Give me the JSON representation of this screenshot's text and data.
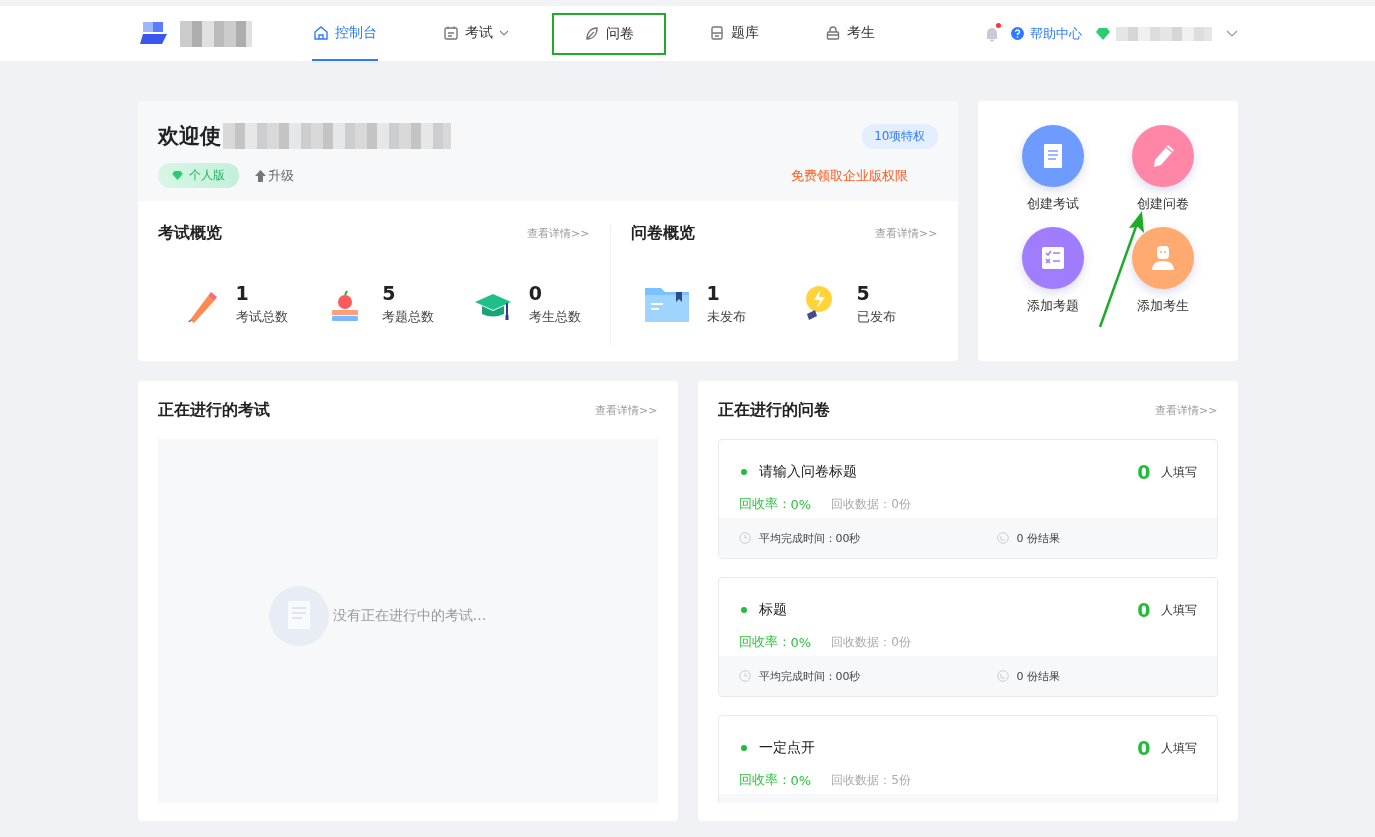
{
  "nav": {
    "items": [
      {
        "label": "控制台",
        "kind": "home",
        "selected": true,
        "dropdown": false,
        "highlighted": false
      },
      {
        "label": "考试",
        "kind": "calendar",
        "selected": false,
        "dropdown": true,
        "highlighted": false
      },
      {
        "label": "问卷",
        "kind": "leaf",
        "selected": false,
        "dropdown": false,
        "highlighted": true
      },
      {
        "label": "题库",
        "kind": "archive",
        "selected": false,
        "dropdown": false,
        "highlighted": false
      },
      {
        "label": "考生",
        "kind": "lock",
        "selected": false,
        "dropdown": false,
        "highlighted": false
      }
    ],
    "notification_dot": true,
    "help": "帮助中心"
  },
  "welcome": {
    "title": "欢迎使",
    "edition": "个人版",
    "upgrade": "升级",
    "badge": "10项特权",
    "promo": "免费领取企业版权限"
  },
  "exam_overview": {
    "title": "考试概览",
    "link": "查看详情>>",
    "stats": [
      {
        "kind": "pencil",
        "value": "1",
        "label": "考试总数"
      },
      {
        "kind": "books",
        "value": "5",
        "label": "考题总数"
      },
      {
        "kind": "cap",
        "value": "0",
        "label": "考生总数"
      }
    ]
  },
  "survey_overview": {
    "title": "问卷概览",
    "link": "查看详情>>",
    "stats": [
      {
        "kind": "folder",
        "value": "1",
        "label": "未发布"
      },
      {
        "kind": "bulb",
        "value": "5",
        "label": "已发布"
      }
    ]
  },
  "quick_actions": [
    {
      "label": "创建考试",
      "kind": "document",
      "color": "#6e9bff"
    },
    {
      "label": "创建问卷",
      "kind": "pen",
      "color": "#ff86a6"
    },
    {
      "label": "添加考题",
      "kind": "checklist",
      "color": "#a07cff"
    },
    {
      "label": "添加考生",
      "kind": "person",
      "color": "#ffaa70"
    }
  ],
  "ongoing_exams": {
    "title": "正在进行的考试",
    "link": "查看详情>>",
    "empty_text": "没有正在进行中的考试..."
  },
  "ongoing_surveys": {
    "title": "正在进行的问卷",
    "link": "查看详情>>",
    "items": [
      {
        "title": "请输入问卷标题",
        "count": "0",
        "count_label": "人填写",
        "rate_label": "回收率：",
        "rate": "0%",
        "data": "回收数据：0份",
        "time": "平均完成时间：00秒",
        "results": "0 份结果"
      },
      {
        "title": "标题",
        "count": "0",
        "count_label": "人填写",
        "rate_label": "回收率：",
        "rate": "0%",
        "data": "回收数据：0份",
        "time": "平均完成时间：00秒",
        "results": "0 份结果"
      },
      {
        "title": "一定点开",
        "count": "0",
        "count_label": "人填写",
        "rate_label": "回收率：",
        "rate": "0%",
        "data": "回收数据：5份"
      }
    ]
  }
}
